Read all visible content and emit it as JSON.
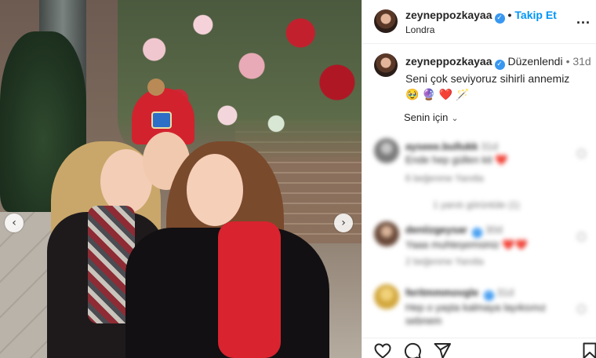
{
  "post": {
    "username": "zeyneppozkayaa",
    "follow_label": "Takip Et",
    "location": "Londra",
    "more_label": "...",
    "edited_label": "Düzenlendi",
    "time": "31d",
    "caption": "Seni çok seviyoruz sihirli annemiz 🥹 🔮 ❤️ 🪄",
    "translate_label": "Senin için"
  },
  "carousel": {
    "prev_label": "‹",
    "next_label": "›"
  },
  "comments": [
    {
      "user": "ayseee.bullukk",
      "time": "31d",
      "text": "Ende hep güllen kit ❤️",
      "meta": "6 beğenme   Yanıtla"
    },
    {
      "user": "deniizgeysar",
      "time": "30d",
      "text": "Yaaa muhteşemsiniz ❤️❤️",
      "meta": "2 beğenme   Yanıtla"
    },
    {
      "user": "feritmmmovgle",
      "time": "31d",
      "text": "Hep o yaşta kalmaya layıksınız sebnem",
      "meta": ""
    }
  ],
  "view_replies_label": "1 yanıtı görüntüle (1)",
  "icons": {
    "verified": "verified-badge-icon",
    "like": "heart-icon",
    "comment": "comment-bubble-icon",
    "share": "paper-plane-icon",
    "save": "bookmark-icon"
  },
  "colors": {
    "link": "#0095f6",
    "verified": "#3897f0",
    "text": "#262626",
    "muted": "#737373"
  }
}
